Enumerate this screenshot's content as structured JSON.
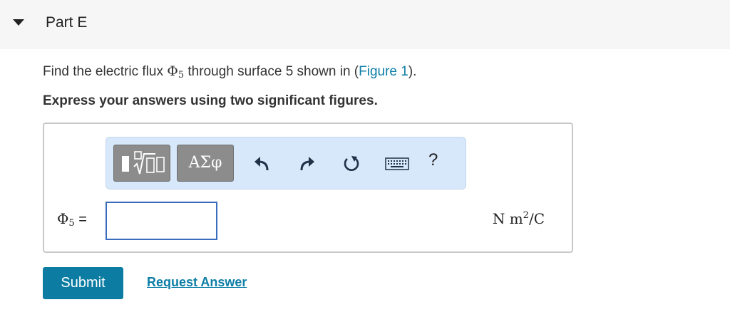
{
  "header": {
    "title": "Part E"
  },
  "question": {
    "text_before": "Find the electric flux ",
    "symbol": "Φ",
    "subscript": "5",
    "text_after": " through surface 5 shown in (",
    "link_label": "Figure 1",
    "text_end": ")."
  },
  "instruction": "Express your answers using two significant figures.",
  "toolbar": {
    "symbols_label": "ΑΣφ",
    "help_label": "?",
    "icons": [
      "templates-icon",
      "undo-icon",
      "redo-icon",
      "reset-icon",
      "keyboard-icon",
      "help-icon"
    ]
  },
  "answer": {
    "label_symbol": "Φ",
    "label_subscript": "5",
    "label_equals": " =",
    "value": "",
    "units_base": "N m",
    "units_exp": "2",
    "units_end": "/C"
  },
  "actions": {
    "submit_label": "Submit",
    "request_label": "Request Answer"
  },
  "colors": {
    "accent": "#0c7ca3",
    "link": "#0d7ea6",
    "toolbar_bg": "#d8e8fb",
    "header_bg": "#f6f6f6"
  }
}
